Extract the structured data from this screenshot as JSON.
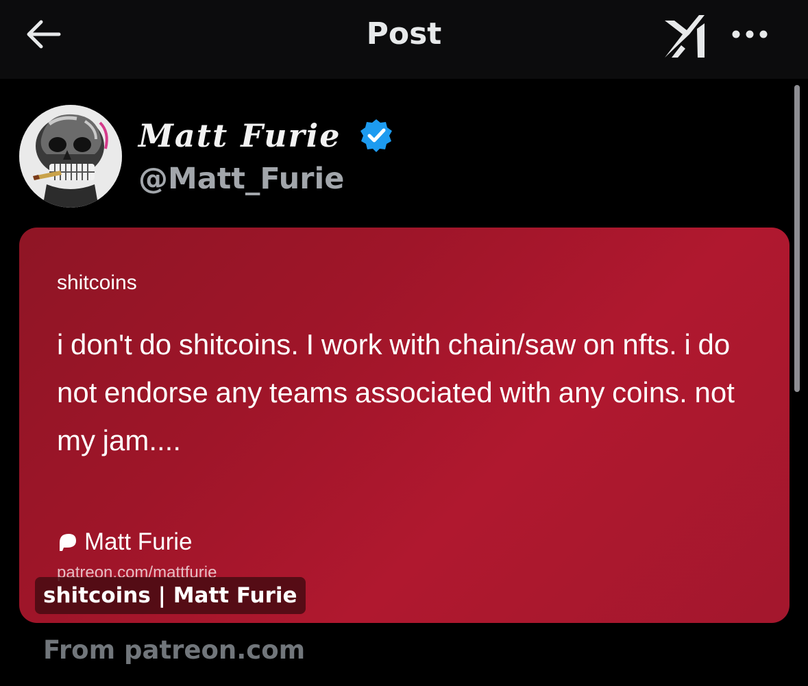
{
  "header": {
    "title": "Post",
    "back_icon": "arrow-left-icon",
    "grok_icon": "grok-icon",
    "more_icon": "more-horizontal-icon"
  },
  "post": {
    "display_name": "Matt Furie",
    "handle": "@Matt_Furie",
    "verified": true,
    "verified_color": "#1d9bf0"
  },
  "link_card": {
    "heading": "shitcoins",
    "body": "i don't do shitcoins. I work with chain/saw on nfts. i do not endorse any teams associated with any coins. not my jam....",
    "author": "Matt Furie",
    "author_icon": "patreon-logo-icon",
    "url": "patreon.com/mattfurie",
    "caption": "shitcoins | Matt Furie",
    "background_color": "#a3172d"
  },
  "source_label": "From patreon.com"
}
